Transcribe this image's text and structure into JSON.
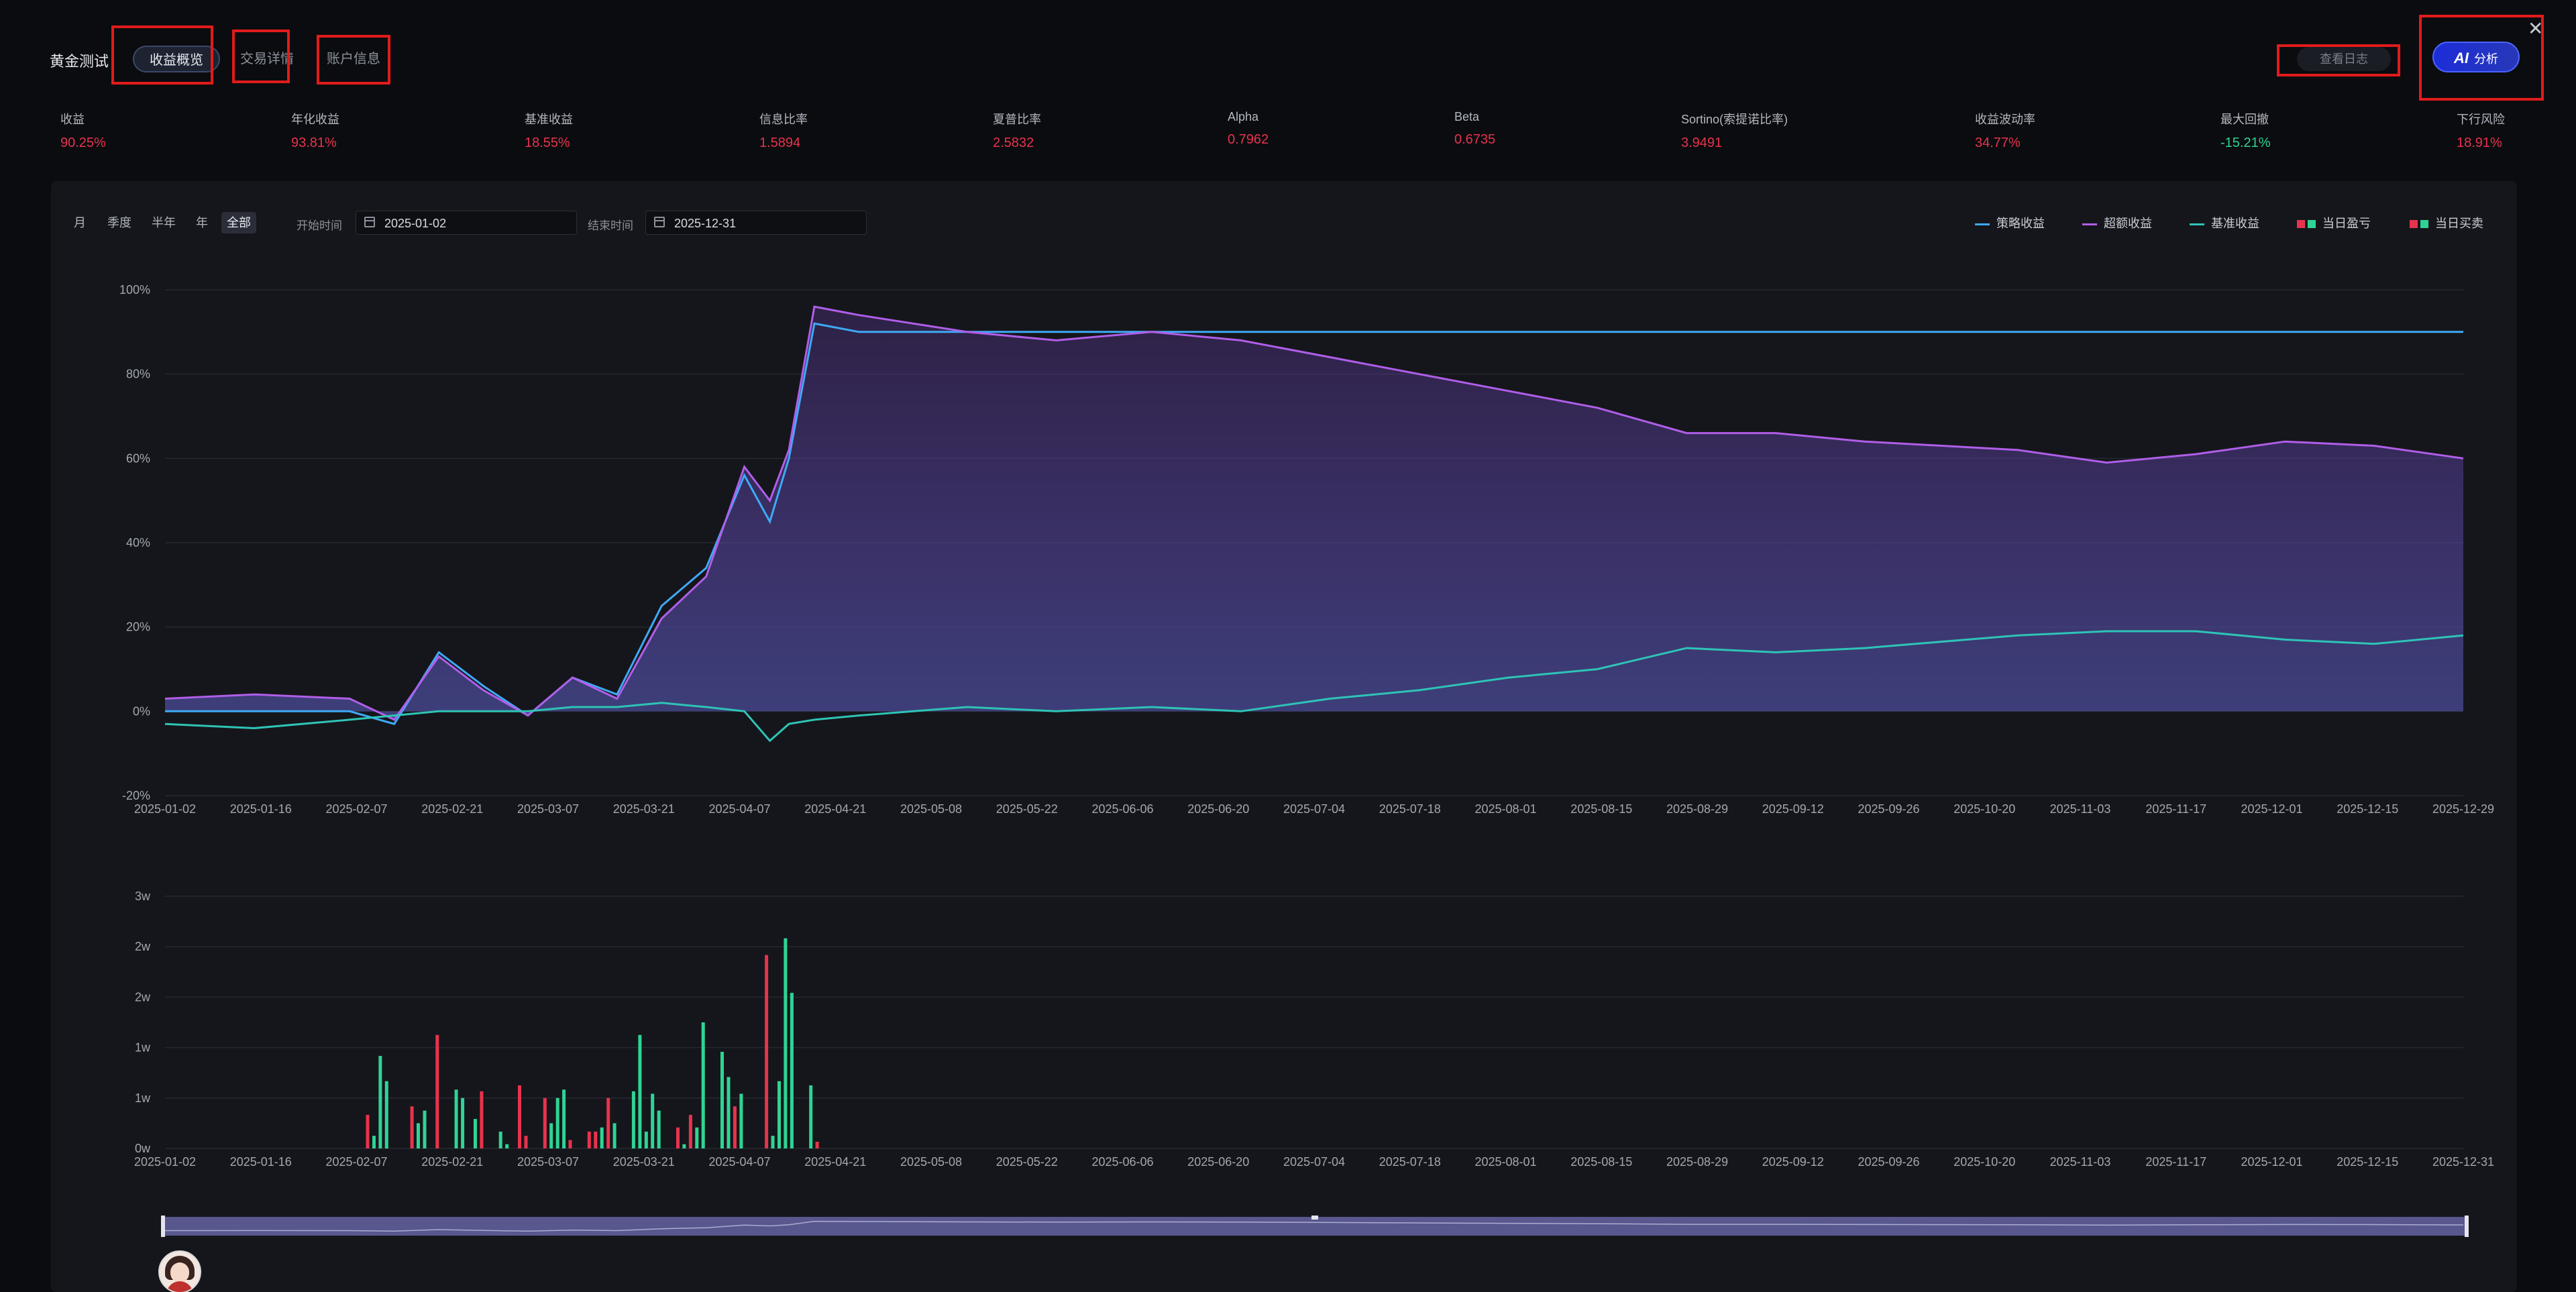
{
  "header": {
    "title": "黄金测试",
    "tabs": [
      {
        "label": "收益概览",
        "active": true
      },
      {
        "label": "交易详情",
        "active": false
      },
      {
        "label": "账户信息",
        "active": false
      }
    ],
    "log_button": "查看日志",
    "ai_button": {
      "icon_text": "AI",
      "label": "分析"
    },
    "close_icon": "close-icon"
  },
  "metrics": [
    {
      "label": "收益",
      "value": "90.25%",
      "color": "#e8334d"
    },
    {
      "label": "年化收益",
      "value": "93.81%",
      "color": "#e8334d"
    },
    {
      "label": "基准收益",
      "value": "18.55%",
      "color": "#e8334d"
    },
    {
      "label": "信息比率",
      "value": "1.5894",
      "color": "#e8334d"
    },
    {
      "label": "夏普比率",
      "value": "2.5832",
      "color": "#e8334d"
    },
    {
      "label": "Alpha",
      "value": "0.7962",
      "color": "#e8334d"
    },
    {
      "label": "Beta",
      "value": "0.6735",
      "color": "#e8334d"
    },
    {
      "label": "Sortino(索提诺比率)",
      "value": "3.9491",
      "color": "#e8334d"
    },
    {
      "label": "收益波动率",
      "value": "34.77%",
      "color": "#e8334d"
    },
    {
      "label": "最大回撤",
      "value": "-15.21%",
      "color": "#2fd494"
    },
    {
      "label": "下行风险",
      "value": "18.91%",
      "color": "#e8334d"
    }
  ],
  "filters": {
    "ranges": [
      {
        "label": "月",
        "active": false
      },
      {
        "label": "季度",
        "active": false
      },
      {
        "label": "半年",
        "active": false
      },
      {
        "label": "年",
        "active": false
      },
      {
        "label": "全部",
        "active": true
      }
    ],
    "start_label": "开始时间",
    "start_value": "2025-01-02",
    "end_label": "结束时间",
    "end_value": "2025-12-31"
  },
  "legend": [
    {
      "label": "策略收益",
      "kind": "line",
      "color": "#3fa9f5"
    },
    {
      "label": "超额收益",
      "kind": "line",
      "color": "#b05ee8"
    },
    {
      "label": "基准收益",
      "kind": "line",
      "color": "#2ec4b6"
    },
    {
      "label": "当日盈亏",
      "kind": "squares",
      "colors": [
        "#e8334d",
        "#2fd494"
      ]
    },
    {
      "label": "当日买卖",
      "kind": "squares",
      "colors": [
        "#e8334d",
        "#2fd494"
      ]
    }
  ],
  "chart_data": [
    {
      "type": "line",
      "ylim": [
        -20,
        100
      ],
      "y_tick_labels": [
        "100%",
        "80%",
        "60%",
        "40%",
        "20%",
        "0%",
        "-20%"
      ],
      "x_tick_labels": [
        "2025-01-02",
        "2025-01-16",
        "2025-02-07",
        "2025-02-21",
        "2025-03-07",
        "2025-03-21",
        "2025-04-07",
        "2025-04-21",
        "2025-05-08",
        "2025-05-22",
        "2025-06-06",
        "2025-06-20",
        "2025-07-04",
        "2025-07-18",
        "2025-08-01",
        "2025-08-15",
        "2025-08-29",
        "2025-09-12",
        "2025-09-26",
        "2025-10-20",
        "2025-11-03",
        "2025-11-17",
        "2025-12-01",
        "2025-12-15",
        "2025-12-29"
      ],
      "x": [
        "2025-01-02",
        "2025-01-16",
        "2025-01-31",
        "2025-02-07",
        "2025-02-14",
        "2025-02-21",
        "2025-02-28",
        "2025-03-07",
        "2025-03-14",
        "2025-03-21",
        "2025-03-28",
        "2025-04-03",
        "2025-04-07",
        "2025-04-10",
        "2025-04-14",
        "2025-04-21",
        "2025-05-08",
        "2025-05-22",
        "2025-06-06",
        "2025-06-20",
        "2025-07-04",
        "2025-07-18",
        "2025-08-01",
        "2025-08-15",
        "2025-08-29",
        "2025-09-12",
        "2025-09-26",
        "2025-10-20",
        "2025-11-03",
        "2025-11-17",
        "2025-12-01",
        "2025-12-15",
        "2025-12-29"
      ],
      "series": [
        {
          "name": "策略收益",
          "color": "#3fa9f5",
          "values": [
            0,
            0,
            0,
            -3,
            14,
            6,
            -1,
            8,
            4,
            25,
            34,
            56,
            45,
            60,
            92,
            90,
            90,
            90,
            90,
            90,
            90,
            90,
            90,
            90,
            90,
            90,
            90,
            90,
            90,
            90,
            90,
            90,
            90
          ]
        },
        {
          "name": "超额收益",
          "color": "#b05ee8",
          "values": [
            3,
            4,
            3,
            -2,
            13,
            5,
            -1,
            8,
            3,
            22,
            32,
            58,
            50,
            62,
            96,
            94,
            90,
            88,
            90,
            88,
            84,
            80,
            76,
            72,
            66,
            66,
            64,
            62,
            59,
            61,
            64,
            63,
            60
          ]
        },
        {
          "name": "基准收益",
          "color": "#2ec4b6",
          "values": [
            -3,
            -4,
            -2,
            -1,
            0,
            0,
            0,
            1,
            1,
            2,
            1,
            0,
            -7,
            -3,
            -2,
            -1,
            1,
            0,
            1,
            0,
            3,
            5,
            8,
            10,
            15,
            14,
            15,
            18,
            19,
            19,
            17,
            16,
            18
          ]
        }
      ]
    },
    {
      "type": "bar",
      "y_tick_labels": [
        "3w",
        "2w",
        "2w",
        "1w",
        "1w",
        "0w"
      ],
      "x_tick_labels": [
        "2025-01-02",
        "2025-01-16",
        "2025-02-07",
        "2025-02-21",
        "2025-03-07",
        "2025-03-21",
        "2025-04-07",
        "2025-04-21",
        "2025-05-08",
        "2025-05-22",
        "2025-06-06",
        "2025-06-20",
        "2025-07-04",
        "2025-07-18",
        "2025-08-01",
        "2025-08-15",
        "2025-08-29",
        "2025-09-12",
        "2025-09-26",
        "2025-10-20",
        "2025-11-03",
        "2025-11-17",
        "2025-12-01",
        "2025-12-15",
        "2025-12-31"
      ],
      "ylim": [
        0,
        3
      ],
      "bars": [
        {
          "x": "2025-02-03",
          "value": 0.4,
          "dir": "up"
        },
        {
          "x": "2025-02-04",
          "value": 0.15,
          "dir": "down"
        },
        {
          "x": "2025-02-05",
          "value": 1.1,
          "dir": "down"
        },
        {
          "x": "2025-02-06",
          "value": 0.8,
          "dir": "down"
        },
        {
          "x": "2025-02-10",
          "value": 0.5,
          "dir": "up"
        },
        {
          "x": "2025-02-11",
          "value": 0.3,
          "dir": "down"
        },
        {
          "x": "2025-02-12",
          "value": 0.45,
          "dir": "down"
        },
        {
          "x": "2025-02-14",
          "value": 1.35,
          "dir": "up"
        },
        {
          "x": "2025-02-17",
          "value": 0.7,
          "dir": "down"
        },
        {
          "x": "2025-02-18",
          "value": 0.6,
          "dir": "down"
        },
        {
          "x": "2025-02-20",
          "value": 0.35,
          "dir": "down"
        },
        {
          "x": "2025-02-21",
          "value": 0.68,
          "dir": "up"
        },
        {
          "x": "2025-02-24",
          "value": 0.2,
          "dir": "down"
        },
        {
          "x": "2025-02-25",
          "value": 0.05,
          "dir": "down"
        },
        {
          "x": "2025-02-27",
          "value": 0.75,
          "dir": "up"
        },
        {
          "x": "2025-02-28",
          "value": 0.15,
          "dir": "up"
        },
        {
          "x": "2025-03-03",
          "value": 0.6,
          "dir": "up"
        },
        {
          "x": "2025-03-04",
          "value": 0.3,
          "dir": "down"
        },
        {
          "x": "2025-03-05",
          "value": 0.6,
          "dir": "down"
        },
        {
          "x": "2025-03-06",
          "value": 0.7,
          "dir": "down"
        },
        {
          "x": "2025-03-07",
          "value": 0.1,
          "dir": "up"
        },
        {
          "x": "2025-03-10",
          "value": 0.2,
          "dir": "up"
        },
        {
          "x": "2025-03-11",
          "value": 0.2,
          "dir": "up"
        },
        {
          "x": "2025-03-12",
          "value": 0.25,
          "dir": "down"
        },
        {
          "x": "2025-03-13",
          "value": 0.6,
          "dir": "up"
        },
        {
          "x": "2025-03-14",
          "value": 0.3,
          "dir": "down"
        },
        {
          "x": "2025-03-17",
          "value": 0.68,
          "dir": "down"
        },
        {
          "x": "2025-03-18",
          "value": 1.35,
          "dir": "down"
        },
        {
          "x": "2025-03-19",
          "value": 0.2,
          "dir": "down"
        },
        {
          "x": "2025-03-20",
          "value": 0.65,
          "dir": "down"
        },
        {
          "x": "2025-03-21",
          "value": 0.45,
          "dir": "down"
        },
        {
          "x": "2025-03-24",
          "value": 0.25,
          "dir": "up"
        },
        {
          "x": "2025-03-25",
          "value": 0.05,
          "dir": "down"
        },
        {
          "x": "2025-03-26",
          "value": 0.4,
          "dir": "up"
        },
        {
          "x": "2025-03-27",
          "value": 0.25,
          "dir": "down"
        },
        {
          "x": "2025-03-28",
          "value": 1.5,
          "dir": "down"
        },
        {
          "x": "2025-03-31",
          "value": 1.15,
          "dir": "down"
        },
        {
          "x": "2025-04-01",
          "value": 0.85,
          "dir": "down"
        },
        {
          "x": "2025-04-02",
          "value": 0.5,
          "dir": "up"
        },
        {
          "x": "2025-04-03",
          "value": 0.65,
          "dir": "down"
        },
        {
          "x": "2025-04-07",
          "value": 2.3,
          "dir": "up"
        },
        {
          "x": "2025-04-08",
          "value": 0.15,
          "dir": "down"
        },
        {
          "x": "2025-04-09",
          "value": 0.8,
          "dir": "down"
        },
        {
          "x": "2025-04-10",
          "value": 2.5,
          "dir": "down"
        },
        {
          "x": "2025-04-11",
          "value": 1.85,
          "dir": "down"
        },
        {
          "x": "2025-04-14",
          "value": 0.75,
          "dir": "down"
        },
        {
          "x": "2025-04-15",
          "value": 0.08,
          "dir": "up"
        }
      ]
    }
  ]
}
